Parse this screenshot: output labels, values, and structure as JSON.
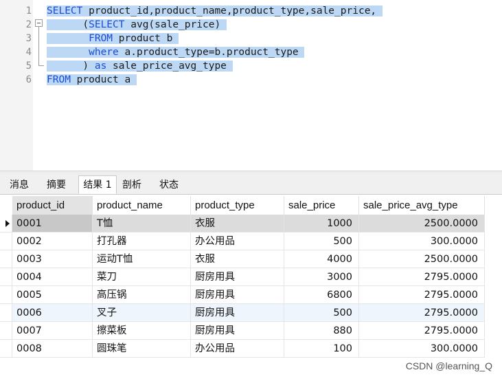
{
  "editor": {
    "line_numbers": [
      "1",
      "2",
      "3",
      "4",
      "5",
      "6"
    ],
    "lines": [
      {
        "kw1": "SELECT",
        "rest": " product_id,product_name,product_type,sale_price,"
      },
      {
        "indent": "      (",
        "kw1": "SELECT",
        "rest": " avg(sale_price)"
      },
      {
        "indent": "       ",
        "kw1": "FROM",
        "rest": " product b"
      },
      {
        "indent": "       ",
        "kw1": "where",
        "rest": " a.product_type=b.product_type"
      },
      {
        "indent": "      ) ",
        "kw1": "as",
        "rest": " sale_price_avg_type"
      },
      {
        "kw1": "FROM",
        "rest": " product a"
      }
    ]
  },
  "tabs": [
    {
      "label": "消息"
    },
    {
      "label": "摘要"
    },
    {
      "label": "结果 1"
    },
    {
      "label": "剖析"
    },
    {
      "label": "状态"
    }
  ],
  "grid": {
    "columns": [
      "product_id",
      "product_name",
      "product_type",
      "sale_price",
      "sale_price_avg_type"
    ],
    "rows": [
      [
        "0001",
        "T恤",
        "衣服",
        "1000",
        "2500.0000"
      ],
      [
        "0002",
        "打孔器",
        "办公用品",
        "500",
        "300.0000"
      ],
      [
        "0003",
        "运动T恤",
        "衣服",
        "4000",
        "2500.0000"
      ],
      [
        "0004",
        "菜刀",
        "厨房用具",
        "3000",
        "2795.0000"
      ],
      [
        "0005",
        "高压锅",
        "厨房用具",
        "6800",
        "2795.0000"
      ],
      [
        "0006",
        "叉子",
        "厨房用具",
        "500",
        "2795.0000"
      ],
      [
        "0007",
        "擦菜板",
        "厨房用具",
        "880",
        "2795.0000"
      ],
      [
        "0008",
        "圆珠笔",
        "办公用品",
        "100",
        "300.0000"
      ]
    ]
  },
  "watermark": "CSDN @learning_Q",
  "colors": {
    "selection": "#bcd8f5",
    "keyword": "#1a4bd6",
    "selected_row": "#dcdcdc"
  }
}
